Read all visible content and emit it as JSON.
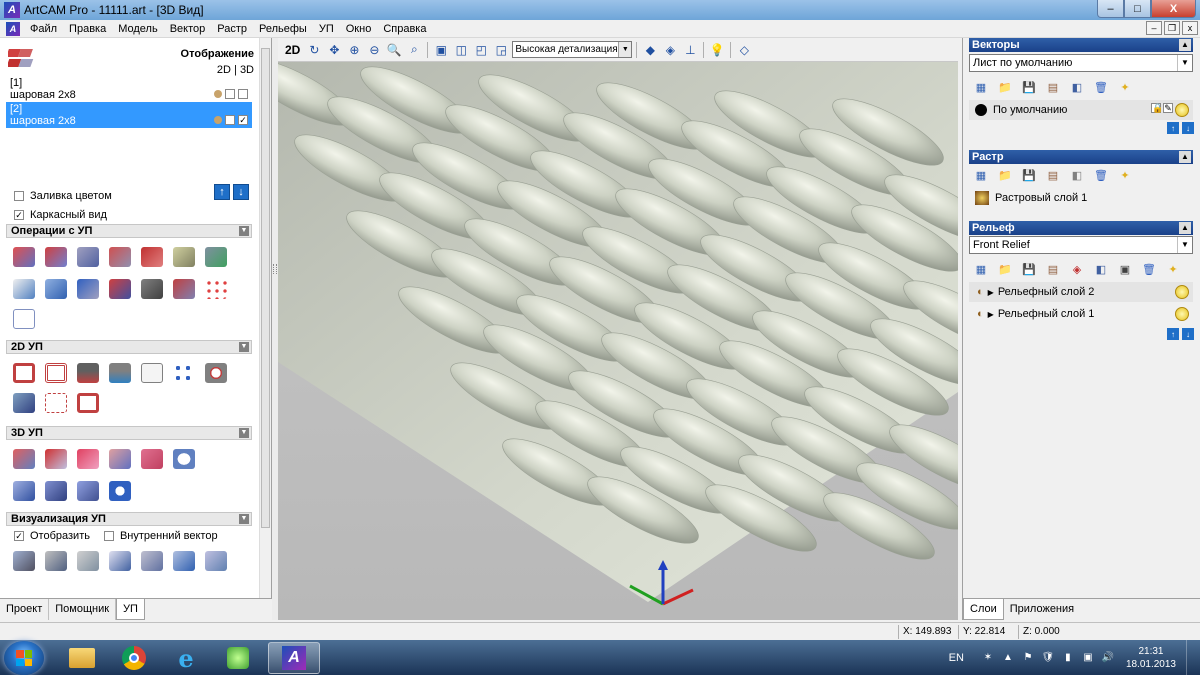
{
  "window": {
    "title": "ArtCAM Pro - 11111.art - [3D Вид]",
    "app_icon_glyph": "A",
    "min_label": "–",
    "max_label": "□",
    "close_label": "X"
  },
  "menu": {
    "items": [
      "Файл",
      "Правка",
      "Модель",
      "Вектор",
      "Растр",
      "Рельефы",
      "УП",
      "Окно",
      "Справка"
    ],
    "mdi_buttons": [
      "–",
      "❐",
      "x"
    ]
  },
  "left_panel": {
    "display_label": "Отображение",
    "display_mode": "2D | 3D",
    "models": [
      {
        "index": "[1]",
        "name": "шаровая 2х8",
        "selected": false,
        "checked": false
      },
      {
        "index": "[2]",
        "name": "шаровая 2х8",
        "selected": true,
        "checked": true
      }
    ],
    "fill_color_label": "Заливка цветом",
    "fill_color_checked": false,
    "wireframe_label": "Каркасный вид",
    "wireframe_checked": true,
    "sections": {
      "ops": "Операции с УП",
      "twod": "2D УП",
      "threed": "3D УП",
      "vis": "Визуализация УП"
    },
    "vis_show_label": "Отобразить",
    "vis_show_checked": true,
    "vis_inner_label": "Внутренний вектор",
    "vis_inner_checked": false,
    "tabs": [
      "Проект",
      "Помощник",
      "УП"
    ],
    "active_tab": "УП"
  },
  "view_toolbar": {
    "btn_2d": "2D",
    "detail_value": "Высокая детализация"
  },
  "right_panel": {
    "vectors_header": "Векторы",
    "vectors_sheet": "Лист по умолчанию",
    "vectors_layer": "По умолчанию",
    "raster_header": "Растр",
    "raster_layer": "Растровый слой 1",
    "relief_header": "Рельеф",
    "relief_combo": "Front Relief",
    "relief_layers": [
      "Рельефный слой 2",
      "Рельефный слой 1"
    ],
    "tabs": [
      "Слои",
      "Приложения"
    ],
    "active_tab": "Слои"
  },
  "status": {
    "x": "X: 149.893",
    "y": "Y: 22.814",
    "z": "Z: 0.000"
  },
  "taskbar": {
    "lang": "EN",
    "time": "21:31",
    "date": "18.01.2013"
  },
  "colors": {
    "title_bar": "#6ea5d8",
    "selection": "#3399ff",
    "panel_header": "#1a4189",
    "view_bg": "#c0c0c0",
    "relief_surface": "#d9ddd0"
  }
}
